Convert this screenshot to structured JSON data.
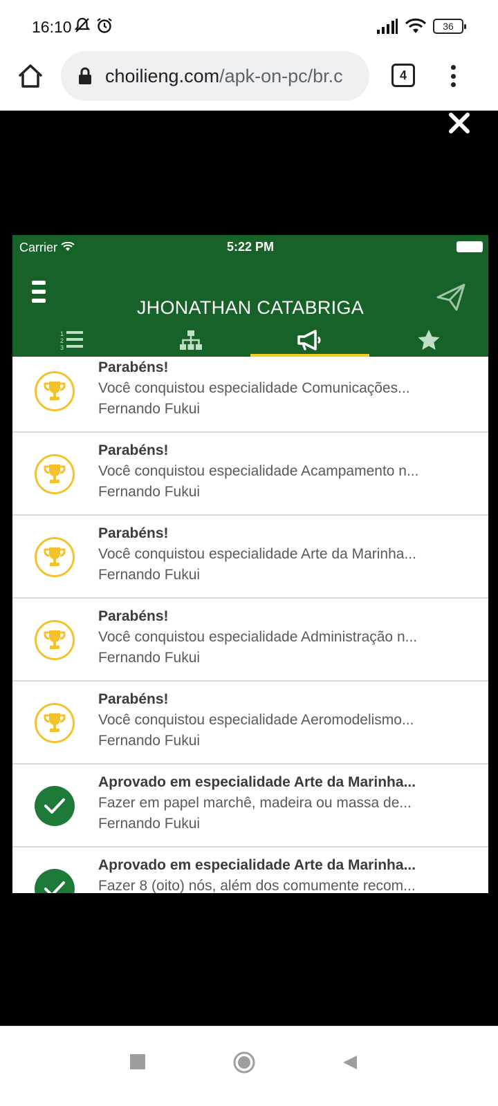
{
  "status_bar": {
    "time": "16:10",
    "battery": "36"
  },
  "browser": {
    "url_domain": "choilieng.com",
    "url_path": "/apk-on-pc/br.c",
    "tab_count": "4"
  },
  "app": {
    "ios_carrier": "Carrier",
    "ios_time": "5:22 PM",
    "title": "JHONATHAN CATABRIGA",
    "tabs": [
      "list-numbered-icon",
      "sitemap-icon",
      "bullhorn-icon",
      "star-icon"
    ],
    "active_tab_index": 2,
    "colors": {
      "header": "#176229",
      "accent": "#f2cd1f",
      "trophy": "#f4c12c",
      "check": "#1e7a39"
    }
  },
  "notifications": [
    {
      "icon": "trophy-icon",
      "title": "Parabéns!",
      "message": "Você conquistou especialidade Comunicações...",
      "author": "Fernando Fukui"
    },
    {
      "icon": "trophy-icon",
      "title": "Parabéns!",
      "message": "Você conquistou especialidade Acampamento n...",
      "author": "Fernando Fukui"
    },
    {
      "icon": "trophy-icon",
      "title": "Parabéns!",
      "message": "Você conquistou especialidade Arte da Marinha...",
      "author": "Fernando Fukui"
    },
    {
      "icon": "trophy-icon",
      "title": "Parabéns!",
      "message": "Você conquistou especialidade Administração n...",
      "author": "Fernando Fukui"
    },
    {
      "icon": "trophy-icon",
      "title": "Parabéns!",
      "message": "Você conquistou especialidade Aeromodelismo...",
      "author": "Fernando Fukui"
    },
    {
      "icon": "check-icon",
      "title": "Aprovado em especialidade Arte da Marinha...",
      "message": "Fazer em papel marchê, madeira ou massa de...",
      "author": "Fernando Fukui"
    },
    {
      "icon": "check-icon",
      "title": "Aprovado em especialidade Arte da Marinha...",
      "message": "Fazer 8 (oito) nós, além dos comumente recom...",
      "author": ""
    }
  ]
}
